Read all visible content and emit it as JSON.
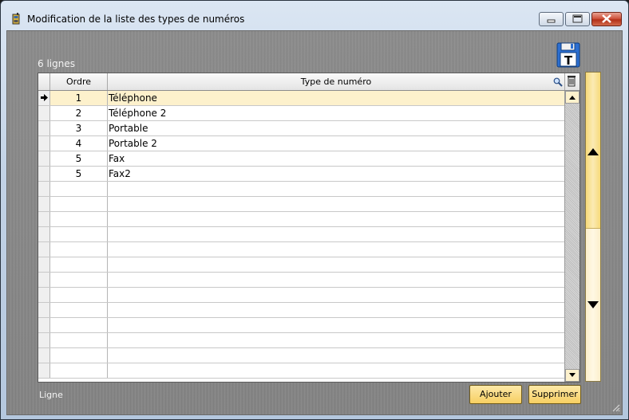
{
  "window": {
    "title": "Modification de la liste des types de numéros"
  },
  "toolbar": {
    "row_count": "6 lignes",
    "save_icon_letter": "T"
  },
  "table": {
    "columns": [
      "Ordre",
      "Type de numéro"
    ],
    "rows": [
      {
        "ordre": "1",
        "type": "Téléphone"
      },
      {
        "ordre": "2",
        "type": "Téléphone 2"
      },
      {
        "ordre": "3",
        "type": "Portable"
      },
      {
        "ordre": "4",
        "type": "Portable 2"
      },
      {
        "ordre": "5",
        "type": "Fax"
      },
      {
        "ordre": "5",
        "type": "Fax2"
      }
    ],
    "active_row": 0,
    "empty_rows": 13
  },
  "footer": {
    "status": "Ligne",
    "add_label": "Ajouter",
    "delete_label": "Supprimer"
  },
  "colors": {
    "active_row": "#fdf1cc",
    "button": "#f7cf62",
    "client_bg": "#878787"
  }
}
